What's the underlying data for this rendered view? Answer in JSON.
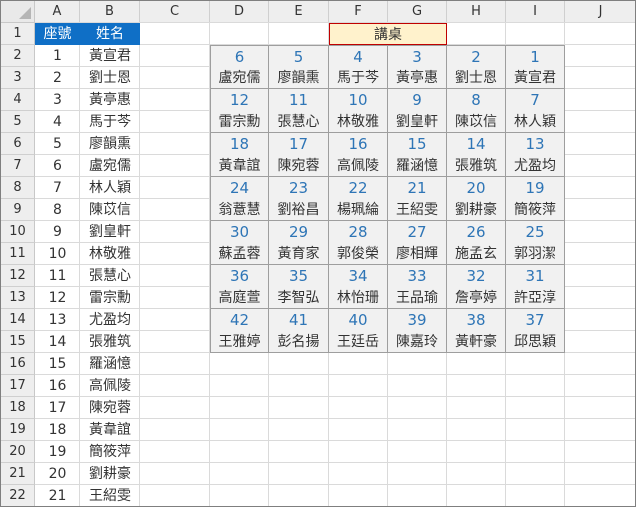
{
  "columns": [
    "A",
    "B",
    "C",
    "D",
    "E",
    "F",
    "G",
    "H",
    "I",
    "J"
  ],
  "rows": [
    "1",
    "2",
    "3",
    "4",
    "5",
    "6",
    "7",
    "8",
    "9",
    "10",
    "11",
    "12",
    "13",
    "14",
    "15",
    "16",
    "17",
    "18",
    "19",
    "20",
    "21",
    "22"
  ],
  "roster": {
    "header_no": "座號",
    "header_name": "姓名",
    "entries": [
      {
        "no": "1",
        "name": "黃宣君"
      },
      {
        "no": "2",
        "name": "劉士恩"
      },
      {
        "no": "3",
        "name": "黃亭惠"
      },
      {
        "no": "4",
        "name": "馬于芩"
      },
      {
        "no": "5",
        "name": "廖韻熏"
      },
      {
        "no": "6",
        "name": "盧宛儒"
      },
      {
        "no": "7",
        "name": "林人穎"
      },
      {
        "no": "8",
        "name": "陳苡信"
      },
      {
        "no": "9",
        "name": "劉皇軒"
      },
      {
        "no": "10",
        "name": "林敬雅"
      },
      {
        "no": "11",
        "name": "張慧心"
      },
      {
        "no": "12",
        "name": "雷宗勳"
      },
      {
        "no": "13",
        "name": "尤盈均"
      },
      {
        "no": "14",
        "name": "張雅筑"
      },
      {
        "no": "15",
        "name": "羅涵憶"
      },
      {
        "no": "16",
        "name": "高佩陵"
      },
      {
        "no": "17",
        "name": "陳宛蓉"
      },
      {
        "no": "18",
        "name": "黃韋誼"
      },
      {
        "no": "19",
        "name": "簡筱萍"
      },
      {
        "no": "20",
        "name": "劉耕豪"
      },
      {
        "no": "21",
        "name": "王紹雯"
      }
    ]
  },
  "podium": "講桌",
  "seating": [
    {
      "nums": [
        "6",
        "5",
        "4",
        "3",
        "2",
        "1"
      ],
      "names": [
        "盧宛儒",
        "廖韻熏",
        "馬于芩",
        "黃亭惠",
        "劉士恩",
        "黃宣君"
      ]
    },
    {
      "nums": [
        "12",
        "11",
        "10",
        "9",
        "8",
        "7"
      ],
      "names": [
        "雷宗勳",
        "張慧心",
        "林敬雅",
        "劉皇軒",
        "陳苡信",
        "林人穎"
      ]
    },
    {
      "nums": [
        "18",
        "17",
        "16",
        "15",
        "14",
        "13"
      ],
      "names": [
        "黃韋誼",
        "陳宛蓉",
        "高佩陵",
        "羅涵憶",
        "張雅筑",
        "尤盈均"
      ]
    },
    {
      "nums": [
        "24",
        "23",
        "22",
        "21",
        "20",
        "19"
      ],
      "names": [
        "翁薏慧",
        "劉裕昌",
        "楊珮綸",
        "王紹雯",
        "劉耕豪",
        "簡筱萍"
      ]
    },
    {
      "nums": [
        "30",
        "29",
        "28",
        "27",
        "26",
        "25"
      ],
      "names": [
        "蘇孟蓉",
        "黃育家",
        "郭俊榮",
        "廖相輝",
        "施孟玄",
        "郭羽潔"
      ]
    },
    {
      "nums": [
        "36",
        "35",
        "34",
        "33",
        "32",
        "31"
      ],
      "names": [
        "高庭萱",
        "李智弘",
        "林怡珊",
        "王品瑜",
        "詹亭婷",
        "許亞淳"
      ]
    },
    {
      "nums": [
        "42",
        "41",
        "40",
        "39",
        "38",
        "37"
      ],
      "names": [
        "王雅婷",
        "彭名揚",
        "王廷岳",
        "陳嘉玲",
        "黃軒豪",
        "邱思穎"
      ]
    }
  ]
}
